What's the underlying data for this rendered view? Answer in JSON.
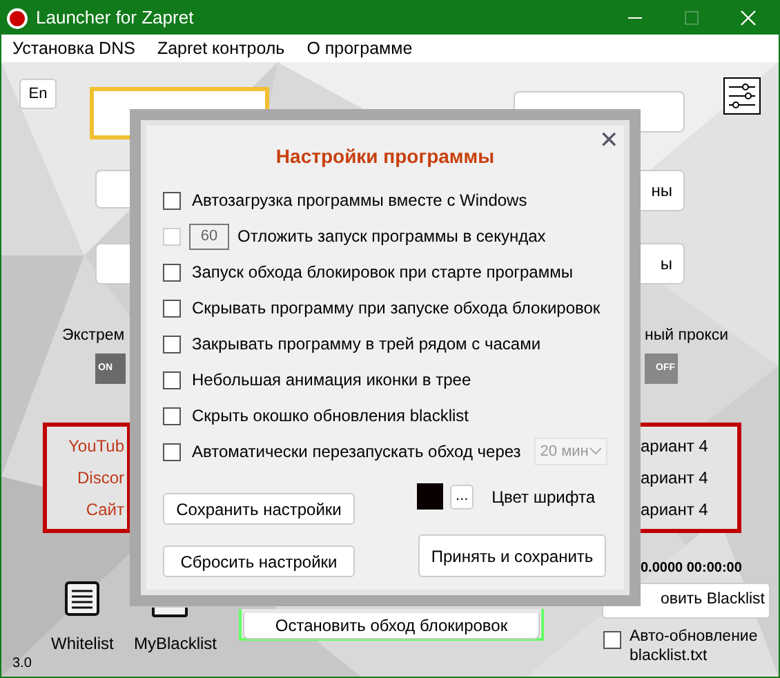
{
  "window": {
    "title": "Launcher for Zapret"
  },
  "menu": [
    "Установка DNS",
    "Zapret контроль",
    "О программе"
  ],
  "main": {
    "language_button": "En",
    "left_label": "Экстрем",
    "right_label": "ный прокси",
    "left_toggle": {
      "label": "ON",
      "on": true
    },
    "right_toggle": {
      "label": "OFF",
      "on": false
    },
    "right_buttons": [
      "ны",
      "ы"
    ],
    "services": [
      "YouTub",
      "Discor",
      "Сайт"
    ],
    "variants": [
      "ариант 4",
      "ариант 4",
      "ариант 4"
    ],
    "update_time": "0.0000 00:00:00",
    "update_button": "овить Blacklist",
    "auto_update": {
      "label": "Авто-обновление blacklist.txt",
      "checked": false
    },
    "whitelist": "Whitelist",
    "myblacklist": "MyBlacklist",
    "stop_button": "Остановить обход блокировок",
    "version": "3.0"
  },
  "dialog": {
    "title": "Настройки программы",
    "close": "✕",
    "options": [
      {
        "kind": "checkbox",
        "label": "Автозагрузка программы вместе с Windows",
        "checked": false,
        "disabled": false
      },
      {
        "kind": "delay",
        "label": "Отложить запуск программы в секундах",
        "value": "60",
        "checked": false,
        "disabled": true
      },
      {
        "kind": "checkbox",
        "label": "Запуск обхода блокировок при старте программы",
        "checked": false,
        "disabled": false
      },
      {
        "kind": "checkbox",
        "label": "Скрывать программу при запуске обхода блокировок",
        "checked": false,
        "disabled": false
      },
      {
        "kind": "checkbox",
        "label": "Закрывать программу в трей рядом с часами",
        "checked": false,
        "disabled": false
      },
      {
        "kind": "checkbox",
        "label": "Небольшая анимация иконки в трее",
        "checked": false,
        "disabled": false
      },
      {
        "kind": "checkbox",
        "label": "Скрыть окошко обновления blacklist",
        "checked": false,
        "disabled": false
      },
      {
        "kind": "select",
        "label": "Автоматически перезапускать обход через",
        "value": "20 мин",
        "checked": false,
        "disabled": false
      }
    ],
    "save_button": "Сохранить настройки",
    "reset_button": "Сбросить настройки",
    "font_color": {
      "color": "#0a0000",
      "button": "...",
      "label": "Цвет шрифта"
    },
    "apply_button": "Принять и сохранить"
  }
}
